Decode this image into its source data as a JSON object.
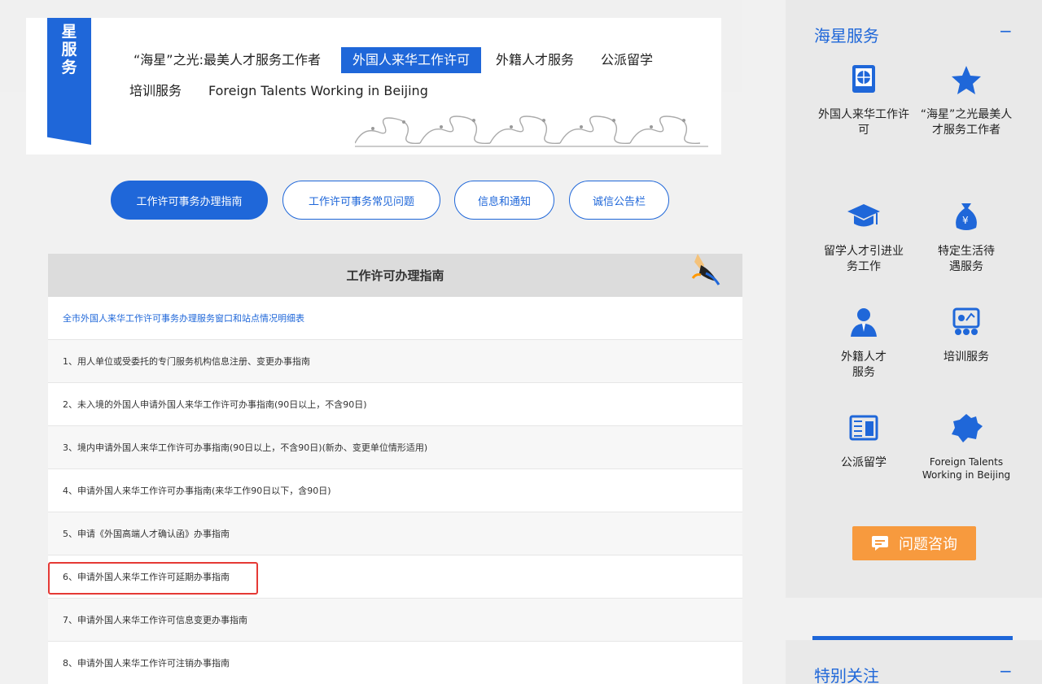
{
  "banner": {
    "tab_label": "星服务",
    "nav": [
      "“海星”之光:最美人才服务工作者",
      "外国人来华工作许可",
      "外籍人才服务",
      "公派留学",
      "培训服务",
      "Foreign Talents Working in Beijing"
    ]
  },
  "pills": [
    "工作许可事务办理指南",
    "工作许可事务常见问题",
    "信息和通知",
    "诚信公告栏"
  ],
  "guide": {
    "title": "工作许可办理指南",
    "items": [
      "全市外国人来华工作许可事务办理服务窗口和站点情况明细表",
      "1、用人单位或受委托的专门服务机构信息注册、变更办事指南",
      "2、未入境的外国人申请外国人来华工作许可办事指南(90日以上，不含90日)",
      "3、境内申请外国人来华工作许可办事指南(90日以上，不含90日)(新办、变更单位情形适用)",
      "4、申请外国人来华工作许可办事指南(来华工作90日以下，含90日)",
      "5、申请《外国高端人才确认函》办事指南",
      "6、申请外国人来华工作许可延期办事指南",
      "7、申请外国人来华工作许可信息变更办事指南",
      "8、申请外国人来华工作许可注销办事指南"
    ]
  },
  "sidebar": {
    "title": "海星服务",
    "collapse_symbol": "−",
    "services": [
      {
        "label": "外国人来华工作许可",
        "icon": "passport-globe-icon"
      },
      {
        "label": "“海星”之光最美人才服务工作者",
        "icon": "star-icon"
      },
      {
        "label": "留学人才引进业务工作",
        "icon": "graduation-cap-icon"
      },
      {
        "label": "特定生活待遇服务",
        "icon": "money-bag-icon"
      },
      {
        "label": "外籍人才服务",
        "icon": "person-icon"
      },
      {
        "label": "培训服务",
        "icon": "presentation-board-icon"
      },
      {
        "label": "公派留学",
        "icon": "newspaper-icon"
      },
      {
        "label": "Foreign Talents Working in Beijing",
        "icon": "beijing-map-icon"
      }
    ],
    "consult_label": "问题咨询"
  },
  "sidebar2": {
    "title": "特别关注",
    "collapse_symbol": "−"
  },
  "colors": {
    "primary": "#1f67d9",
    "accent_orange": "#f79a3e",
    "highlight_red": "#e53935"
  }
}
